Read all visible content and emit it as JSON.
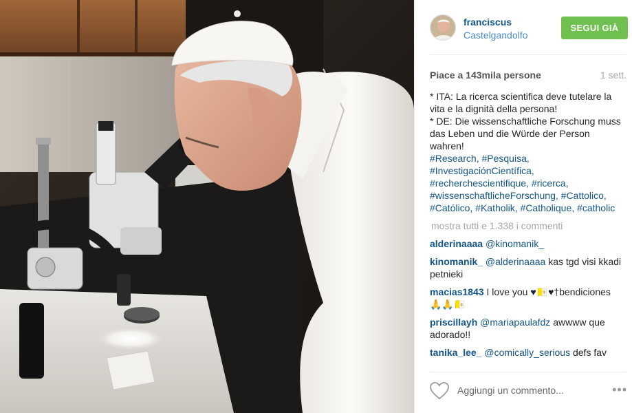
{
  "post": {
    "photo_icon": "photo-microscope"
  },
  "header": {
    "username": "franciscus",
    "location": "Castelgandolfo",
    "follow_label": "SEGUI GIÀ",
    "follow_color": "#70c050"
  },
  "meta": {
    "likes": "Piace a 143mila persone",
    "time": "1 sett."
  },
  "caption": {
    "line1": "* ITA: La ricerca scientifica deve tutelare la vita e la dignità della persona!",
    "line2": "* DE: Die wissenschaftliche Forschung muss das Leben und die Würde der Person wahren!",
    "hashtags": [
      "#Research",
      "#Pesquisa",
      "#InvestigaciónCientífica",
      "#recherchescientifique",
      "#ricerca",
      "#wissenschaftlicheForschung",
      "#Cattolico",
      "#Católico",
      "#Katholik",
      "#Catholique",
      "#catholic"
    ]
  },
  "view_all": "mostra tutti e 1.338 i commenti",
  "comments": [
    {
      "user": "alderinaaaa",
      "mention": "@kinomanik_",
      "text": ""
    },
    {
      "user": "kinomanik_",
      "mention": "@alderinaaaa",
      "text": "kas tgd visi kkadi petnieki"
    },
    {
      "user": "macias1843",
      "mention": "",
      "text": "I love you ♥🇻🇦♥†bendiciones 🙏🙏🇻🇦"
    },
    {
      "user": "priscillayh",
      "mention": "@mariapaulafdz",
      "text": "awwww que adorado!!"
    },
    {
      "user": "tanika_lee_",
      "mention": "@comically_serious",
      "text": "defs fav"
    }
  ],
  "footer": {
    "comment_placeholder": "Aggiungi un commento...",
    "more_icon": "more-icon",
    "heart_icon": "heart-icon"
  },
  "colors": {
    "link": "#125688",
    "muted": "#a5a7aa",
    "follow": "#70c050"
  }
}
